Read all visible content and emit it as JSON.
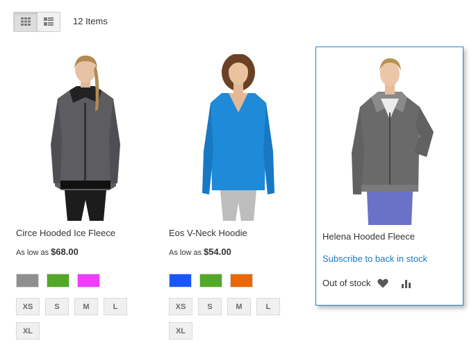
{
  "toolbar": {
    "modes": [
      {
        "name": "Grid",
        "icon": "grid-icon",
        "active": true
      },
      {
        "name": "List",
        "icon": "list-icon",
        "active": false
      }
    ],
    "items_count": "12 Items"
  },
  "products": [
    {
      "name": "Circe Hooded Ice Fleece",
      "price_prefix": "As low as",
      "price": "$68.00",
      "colors": [
        "#8f8f8f",
        "#53a828",
        "#ef3dff"
      ],
      "sizes": [
        "XS",
        "S",
        "M",
        "L",
        "XL"
      ]
    },
    {
      "name": "Eos V-Neck Hoodie",
      "price_prefix": "As low as",
      "price": "$54.00",
      "colors": [
        "#1857f7",
        "#53a828",
        "#eb6703"
      ],
      "sizes": [
        "XS",
        "S",
        "M",
        "L",
        "XL"
      ]
    },
    {
      "name": "Helena Hooded Fleece",
      "subscribe_label": "Subscribe to back in stock",
      "stock_status": "Out of stock",
      "actions": [
        "heart-icon",
        "bar-chart-icon"
      ]
    }
  ]
}
